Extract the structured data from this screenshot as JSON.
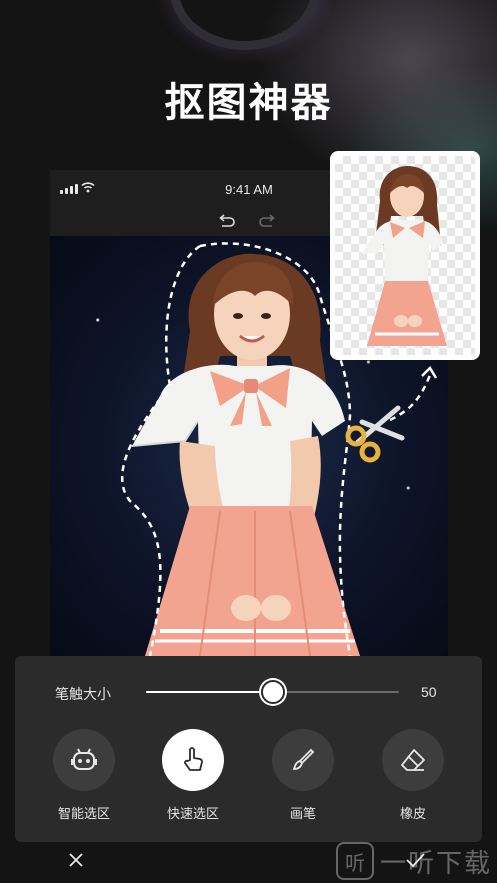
{
  "headline": "抠图神器",
  "status_bar": {
    "time": "9:41 AM"
  },
  "toolbar": {
    "undo_icon": "undo-icon",
    "redo_icon": "redo-icon"
  },
  "brush": {
    "label": "笔触大小",
    "value": "50",
    "level_fraction": 0.5
  },
  "tools": [
    {
      "label": "智能选区",
      "icon": "robot-icon",
      "active": false
    },
    {
      "label": "快速选区",
      "icon": "hand-pointer-icon",
      "active": true
    },
    {
      "label": "画笔",
      "icon": "brush-icon",
      "active": false
    },
    {
      "label": "橡皮",
      "icon": "eraser-icon",
      "active": false
    }
  ],
  "footer": {
    "cancel_icon": "close-icon",
    "confirm_icon": "check-icon"
  },
  "watermark": {
    "icon_text": "听",
    "text": "一听下载"
  },
  "colors": {
    "background": "#141414",
    "panel": "#2b2b2b",
    "tool_circle": "#3d3d3d",
    "accent_scissors": "#e8b33a",
    "skirt": "#f2a491",
    "bow": "#f3a088"
  }
}
